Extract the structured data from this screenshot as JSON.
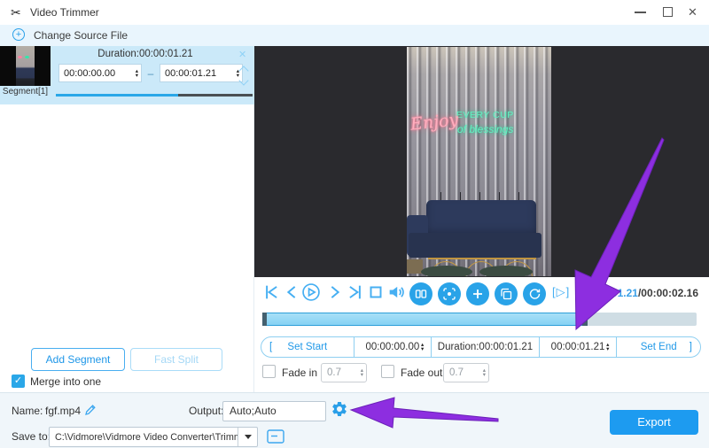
{
  "window": {
    "title": "Video Trimmer"
  },
  "toolbar": {
    "change_source_label": "Change Source File"
  },
  "segments": {
    "duration_label": "Duration:00:00:01.21",
    "start_time": "00:00:00.00",
    "range_separator": "–",
    "end_time": "00:00:01.21",
    "name": "Segment[1]",
    "progress_percent": 62
  },
  "segment_actions": {
    "add_segment_label": "Add Segment",
    "fast_split_label": "Fast Split",
    "merge_label": "Merge into one"
  },
  "preview": {
    "neon_script": "Enjoy",
    "neon_caps": "EVERY CUP",
    "neon_sub": "of blessings"
  },
  "player": {
    "segment_play_icon": "[▷]",
    "segment_frame_icon": "[□]",
    "current_time": "00:00:01.21",
    "total_time": "/00:00:02.16",
    "timeline_selection_percent": 74.7
  },
  "trim": {
    "open_bracket": "[",
    "set_start_label": "Set Start",
    "start_time": "00:00:00.00",
    "duration_label": "Duration:00:00:01.21",
    "end_time": "00:00:01.21",
    "set_end_label": "Set End",
    "close_bracket": "]"
  },
  "fade": {
    "in_label": "Fade in",
    "in_value": "0.7",
    "out_label": "Fade out",
    "out_value": "0.7"
  },
  "footer": {
    "name_label": "Name:",
    "file_name": "fgf.mp4",
    "output_label": "Output:",
    "output_value": "Auto;Auto",
    "save_to_label": "Save to:",
    "save_path": "C:\\Vidmore\\Vidmore Video Converter\\Trimmer",
    "export_label": "Export"
  },
  "colors": {
    "accent": "#2aa3e8",
    "annotation_arrow": "#8d2ee0"
  }
}
